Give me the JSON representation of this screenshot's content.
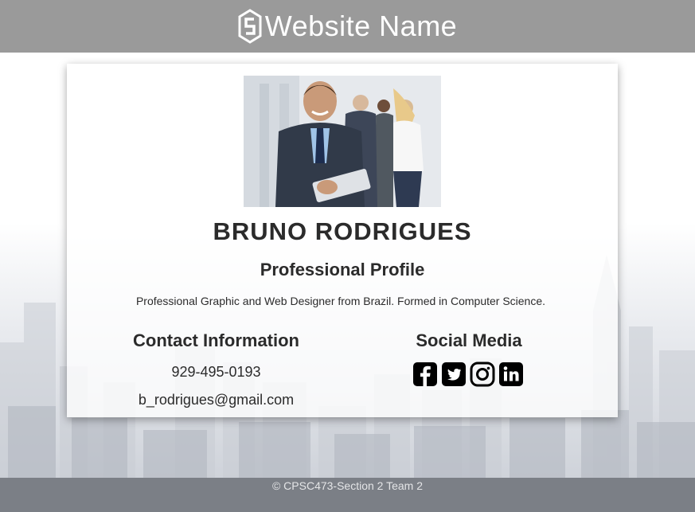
{
  "header": {
    "site_name": "Website Name",
    "logo_icon": "hexagon-s-logo-icon"
  },
  "profile": {
    "photo_icon": "profile-photo",
    "name": "BRUNO RODRIGUES",
    "subtitle": "Professional Profile",
    "bio": "Professional Graphic and Web Designer from Brazil. Formed in Computer Science."
  },
  "contact": {
    "heading": "Contact Information",
    "phone": "929-495-0193",
    "email": "b_rodrigues@gmail.com"
  },
  "social": {
    "heading": "Social Media",
    "icons": [
      "facebook-icon",
      "twitter-icon",
      "instagram-icon",
      "linkedin-icon"
    ]
  },
  "footer": {
    "text": "© CPSC473-Section 2 Team 2"
  },
  "colors": {
    "header_bg": "#9a9a9a",
    "footer_bg": "#7b7f86",
    "text": "#2b2b2b"
  }
}
